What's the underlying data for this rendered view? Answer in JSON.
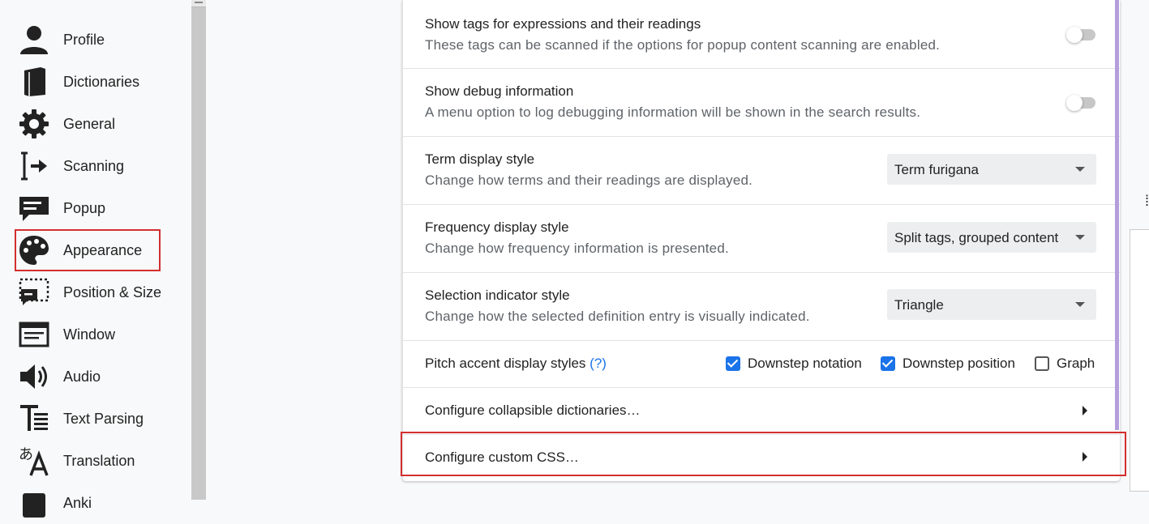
{
  "sidebar": {
    "items": [
      {
        "label": "Profile",
        "icon": "person-icon"
      },
      {
        "label": "Dictionaries",
        "icon": "book-icon"
      },
      {
        "label": "General",
        "icon": "gear-icon"
      },
      {
        "label": "Scanning",
        "icon": "text-cursor-arrow-icon"
      },
      {
        "label": "Popup",
        "icon": "popup-message-icon"
      },
      {
        "label": "Appearance",
        "icon": "palette-icon",
        "active": true
      },
      {
        "label": "Position & Size",
        "icon": "position-size-icon"
      },
      {
        "label": "Window",
        "icon": "window-icon"
      },
      {
        "label": "Audio",
        "icon": "speaker-icon"
      },
      {
        "label": "Text Parsing",
        "icon": "text-parsing-icon"
      },
      {
        "label": "Translation",
        "icon": "translate-icon"
      },
      {
        "label": "Anki",
        "icon": "anki-icon"
      }
    ]
  },
  "settings": {
    "show_tags": {
      "title": "Show tags for expressions and their readings",
      "desc": "These tags can be scanned if the options for popup content scanning are enabled.",
      "enabled": false
    },
    "show_debug": {
      "title": "Show debug information",
      "desc": "A menu option to log debugging information will be shown in the search results.",
      "enabled": false
    },
    "term_display": {
      "title": "Term display style",
      "desc": "Change how terms and their readings are displayed.",
      "value": "Term furigana"
    },
    "frequency_display": {
      "title": "Frequency display style",
      "desc": "Change how frequency information is presented.",
      "value": "Split tags, grouped content"
    },
    "selection_indicator": {
      "title": "Selection indicator style",
      "desc": "Change how the selected definition entry is visually indicated.",
      "value": "Triangle"
    },
    "pitch_accent": {
      "title": "Pitch accent display styles",
      "help": "(?)",
      "options": [
        {
          "label": "Downstep notation",
          "checked": true
        },
        {
          "label": "Downstep position",
          "checked": true
        },
        {
          "label": "Graph",
          "checked": false
        }
      ]
    },
    "collapsible": {
      "title": "Configure collapsible dictionaries…"
    },
    "custom_css": {
      "title": "Configure custom CSS…"
    }
  },
  "colors": {
    "highlight": "#d32f2f",
    "accent": "#b39ddb",
    "checkbox": "#1a73e8"
  }
}
